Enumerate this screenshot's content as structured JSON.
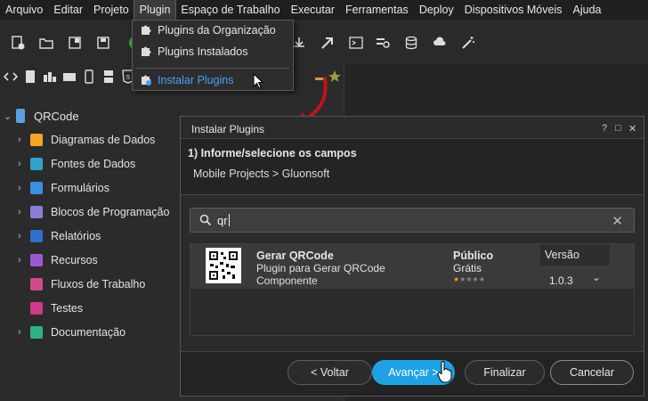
{
  "menubar": {
    "items": [
      "Arquivo",
      "Editar",
      "Projeto",
      "Plugin",
      "Espaço de Trabalho",
      "Executar",
      "Ferramentas",
      "Deploy",
      "Dispositivos Móveis",
      "Ajuda"
    ],
    "active": "Plugin"
  },
  "plugin_menu": {
    "items": [
      {
        "label": "Plugins da Organização"
      },
      {
        "label": "Plugins Instalados"
      },
      {
        "label": "Instalar Plugins"
      }
    ]
  },
  "tree": {
    "root": "QRCode",
    "items": [
      {
        "label": "Diagramas de Dados",
        "icon": "diagram-icon",
        "color": "#f5a623",
        "expandable": true
      },
      {
        "label": "Fontes de Dados",
        "icon": "datasource-icon",
        "color": "#2fa3c9",
        "expandable": true
      },
      {
        "label": "Formulários",
        "icon": "form-icon",
        "color": "#3b8fe0",
        "expandable": true
      },
      {
        "label": "Blocos de Programação",
        "icon": "blocks-icon",
        "color": "#8a7fd6",
        "expandable": true
      },
      {
        "label": "Relatórios",
        "icon": "report-icon",
        "color": "#2f6fd0",
        "expandable": true
      },
      {
        "label": "Recursos",
        "icon": "resources-icon",
        "color": "#9b59d0",
        "expandable": true
      },
      {
        "label": "Fluxos de Trabalho",
        "icon": "workflow-icon",
        "color": "#d04a8a",
        "expandable": false
      },
      {
        "label": "Testes",
        "icon": "tests-icon",
        "color": "#d03a8a",
        "expandable": false
      },
      {
        "label": "Documentação",
        "icon": "docs-icon",
        "color": "#2fb08a",
        "expandable": true
      }
    ]
  },
  "dialog": {
    "title": "Instalar Plugins",
    "controls": [
      "?",
      "□",
      "✕"
    ],
    "step_title": "1) Informe/selecione os campos",
    "breadcrumb": "Mobile Projects > Gluonsoft",
    "search_value": "qr",
    "plugin": {
      "name": "Gerar QRCode",
      "description": "Plugin para Gerar QRCode",
      "category": "Componente",
      "visibility": "Público",
      "price": "Grátis",
      "rating": 1,
      "rating_max": 5,
      "version_header": "Versão",
      "version": "1.0.3"
    },
    "buttons": {
      "back": "< Voltar",
      "next": "Avançar >",
      "finish": "Finalizar",
      "cancel": "Cancelar"
    }
  },
  "colors": {
    "accent": "#1fa1e6",
    "arrow": "#c0121a",
    "menu_highlight": "#4a9eff"
  }
}
